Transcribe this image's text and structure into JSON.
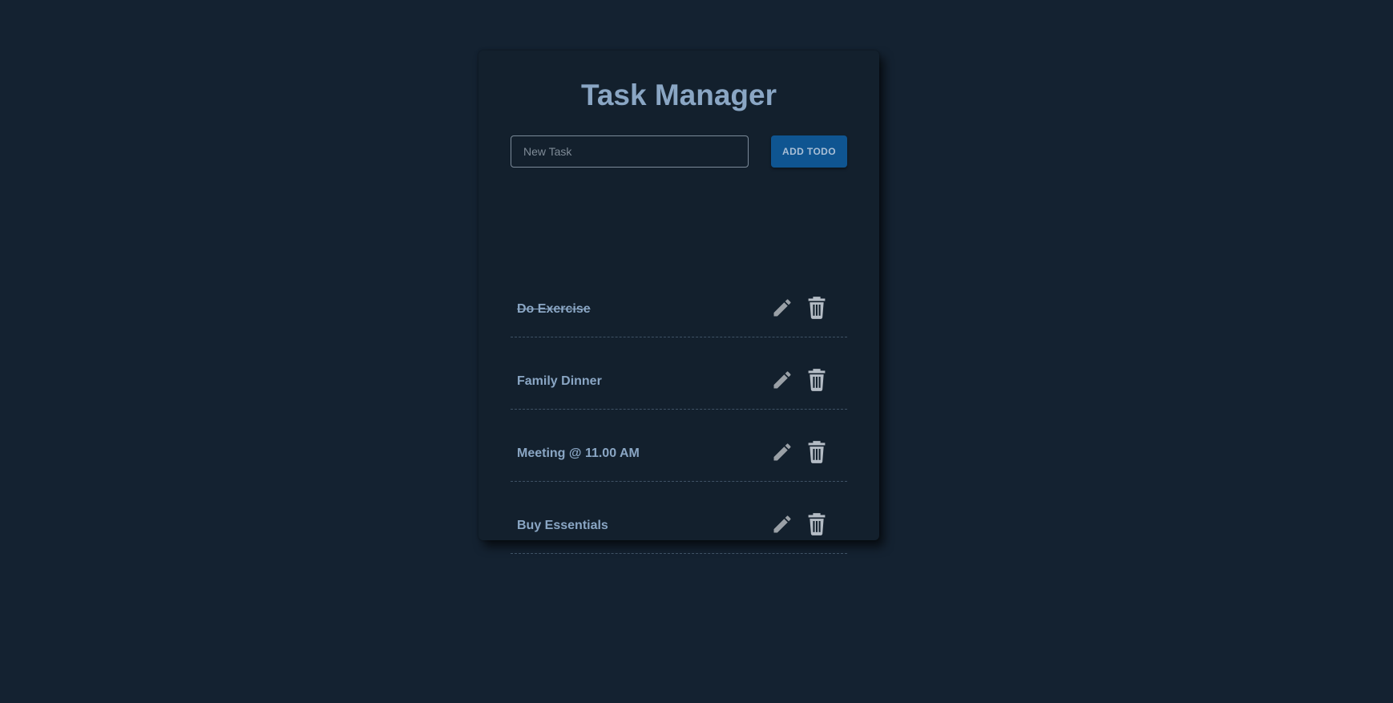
{
  "app": {
    "title": "Task Manager"
  },
  "form": {
    "input_value": "",
    "input_placeholder": "New Task",
    "add_label": "ADD TODO"
  },
  "todos": [
    {
      "text": "Do Exercise",
      "completed": true
    },
    {
      "text": "Family Dinner",
      "completed": false
    },
    {
      "text": "Meeting @ 11.00 AM",
      "completed": false
    },
    {
      "text": "Buy Essentials",
      "completed": false
    }
  ],
  "icons": {
    "edit": "pencil-icon",
    "delete": "trash-icon"
  },
  "colors": {
    "background": "#142231",
    "card": "#13202d",
    "accent": "#0f5591",
    "text": "#8aa6c4",
    "icon_edit": "#9aa0a6",
    "icon_delete": "#b4bcc5"
  }
}
